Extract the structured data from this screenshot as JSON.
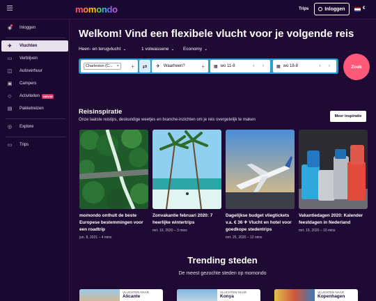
{
  "header": {
    "logo": [
      "m",
      "o",
      "m",
      "o",
      "n",
      "d",
      "o"
    ],
    "logo_colors": [
      "#ff4f6d",
      "#ff8a3d",
      "#ffc21f",
      "#6ad15a",
      "#27b8e6",
      "#7a6cf2",
      "#c25be0"
    ],
    "trips": "Trips",
    "login": "Inloggen",
    "currency": "€"
  },
  "sidebar": {
    "items": [
      {
        "label": "Inloggen",
        "icon": "user-icon"
      },
      {
        "label": "Vluchten",
        "icon": "plane-icon"
      },
      {
        "label": "Verblijven",
        "icon": "bed-icon"
      },
      {
        "label": "Autoverhuur",
        "icon": "car-icon"
      },
      {
        "label": "Campers",
        "icon": "camper-icon"
      },
      {
        "label": "Activiteiten",
        "icon": "ticket-icon",
        "badge": "NIEUW"
      },
      {
        "label": "Pakketreizen",
        "icon": "suitcase-icon"
      },
      {
        "label": "Explore",
        "icon": "globe-icon"
      },
      {
        "label": "Trips",
        "icon": "trips-icon"
      }
    ]
  },
  "hero": {
    "title": "Welkom! Vind een flexibele vlucht voor je volgende reis",
    "trip_type": "Heen- en terugvlucht",
    "passengers": "1 volwassene",
    "cabin": "Economy"
  },
  "search": {
    "origin": "Charleston (C...",
    "destination_placeholder": "Waarheen?",
    "depart": "wo 11-8",
    "return": "wo 18-8",
    "submit": "Zoek"
  },
  "inspiration": {
    "title": "Reisinspiratie",
    "subtitle": "Onze laatste reistips, deskundige weetjes en branche-inzichten om je reis overgetelijk te maken",
    "more": "Meer inspiratie",
    "cards": [
      {
        "title": "momondo onthult de beste Europese bestemmingen voor een roadtrip",
        "meta": "jun. 8, 2021 – 4 mins"
      },
      {
        "title": "Zonvakantie februari 2020: 7 heerlijke wintertrips",
        "meta": "mrt. 19, 2020 – 3 mins"
      },
      {
        "title": "Dagelijkse budget vliegtickets v.a. € 36 ✈ Vlucht en hotel voor goedkope stedentrips",
        "meta": "mrt. 25, 2020 – 12 mins"
      },
      {
        "title": "Vakantiedagen 2020: Kalender feestdagen in Nederland",
        "meta": "mrt. 19, 2020 – 10 mins"
      }
    ]
  },
  "trending": {
    "title": "Trending steden",
    "subtitle": "De meest gezochte steden op momondo",
    "cities": [
      {
        "label": "VLUCHTEN NAAR",
        "name": "Alicante"
      },
      {
        "label": "VLUCHTEN NAAR",
        "name": "Konya"
      },
      {
        "label": "VLUCHTEN NAAR",
        "name": "Kopenhagen"
      }
    ]
  }
}
